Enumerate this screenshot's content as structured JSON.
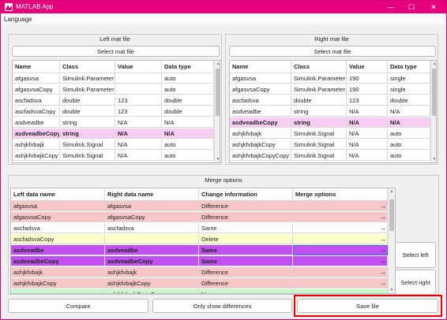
{
  "window": {
    "title": "MATLAB App",
    "minimize_glyph": "—",
    "maximize_glyph": "☐",
    "close_glyph": "✕"
  },
  "menu": {
    "language": "Language"
  },
  "left_panel": {
    "title": "Left mat file",
    "select_button": "Select mat file",
    "columns": [
      "Name",
      "Class",
      "Value",
      "Data type"
    ],
    "rows": [
      {
        "name": "afgasvsa",
        "class": "Simulink.Parameter",
        "value": "",
        "type": "auto"
      },
      {
        "name": "afgasvsaCopy",
        "class": "Simulink.Parameter",
        "value": "",
        "type": "auto"
      },
      {
        "name": "ascfadsva",
        "class": "double",
        "value": "123",
        "type": "double"
      },
      {
        "name": "ascfadsvaCopy",
        "class": "double",
        "value": "123",
        "type": "double"
      },
      {
        "name": "asdveadbe",
        "class": "string",
        "value": "N/A",
        "type": "N/A"
      },
      {
        "name": "asdveadbeCopy",
        "class": "string",
        "value": "N/A",
        "type": "N/A"
      },
      {
        "name": "ashjkfvbajk",
        "class": "Simulink.Signal",
        "value": "N/A",
        "type": "auto"
      },
      {
        "name": "ashjkfvbajkCopy",
        "class": "Simulink.Signal",
        "value": "N/A",
        "type": "auto"
      }
    ]
  },
  "right_panel": {
    "title": "Right mat file",
    "select_button": "Select mat file",
    "columns": [
      "Name",
      "Class",
      "Value",
      "Data type"
    ],
    "rows": [
      {
        "name": "afgasvsa",
        "class": "Simulink.Parameter",
        "value": "190",
        "type": "single"
      },
      {
        "name": "afgasvsaCopy",
        "class": "Simulink.Parameter",
        "value": "190",
        "type": "single"
      },
      {
        "name": "ascfadsva",
        "class": "double",
        "value": "123",
        "type": "double"
      },
      {
        "name": "asdveadbe",
        "class": "string",
        "value": "N/A",
        "type": "N/A"
      },
      {
        "name": "asdveadbeCopy",
        "class": "string",
        "value": "N/A",
        "type": "N/A"
      },
      {
        "name": "ashjkfvbajk",
        "class": "Simulink.Signal",
        "value": "N/A",
        "type": "auto"
      },
      {
        "name": "ashjkfvbajkCopy",
        "class": "Simulink.Signal",
        "value": "N/A",
        "type": "auto"
      },
      {
        "name": "ashjkfvbajkCopyCopy",
        "class": "Simulink.Signal",
        "value": "N/A",
        "type": "auto"
      }
    ]
  },
  "merge_panel": {
    "title": "Merge options",
    "columns": [
      "Left data name",
      "Right data name",
      "Change information",
      "Merge options"
    ],
    "arrow_glyph": "→",
    "rows": [
      {
        "left": "afgasvsa",
        "right": "afgasvsa",
        "change": "Difference"
      },
      {
        "left": "afgasvsaCopy",
        "right": "afgasvsaCopy",
        "change": "Difference"
      },
      {
        "left": "ascfadsva",
        "right": "ascfadsva",
        "change": "Same"
      },
      {
        "left": "ascfadsvaCopy",
        "right": "",
        "change": "Delete"
      },
      {
        "left": "asdveadbe",
        "right": "asdveadbe",
        "change": "Same"
      },
      {
        "left": "asdveadbeCopy",
        "right": "asdveadbeCopy",
        "change": "Same"
      },
      {
        "left": "ashjkfvbajk",
        "right": "ashjkfvbajk",
        "change": "Difference"
      },
      {
        "left": "ashjkfvbajkCopy",
        "right": "ashjkfvbajkCopy",
        "change": "Difference"
      },
      {
        "left": "",
        "right": "ashjkfvbajkCopyCopy",
        "change": "New"
      }
    ],
    "select_left": "Select left",
    "select_right": "Select right"
  },
  "bottom": {
    "compare": "Compare",
    "only_diff": "Only show differences",
    "save": "Save file"
  },
  "colors": {
    "title_bar": "#e6007e",
    "pink_selected": "#f8cdf4",
    "difference": "#f7c6c6",
    "same": "#ffffff",
    "delete": "#ffffcc",
    "purple": "#c050f0",
    "new": "#c8f7c8",
    "highlight": "#e60000"
  }
}
